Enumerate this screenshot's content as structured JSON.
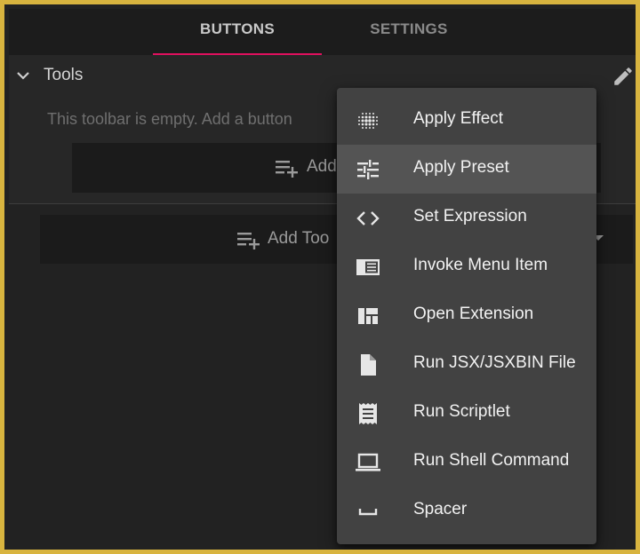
{
  "tabs": [
    {
      "label": "BUTTONS",
      "active": true
    },
    {
      "label": "SETTINGS",
      "active": false
    }
  ],
  "accent_color": "#e0115f",
  "frame_color": "#d8b43f",
  "section": {
    "title": "Tools",
    "empty_message": "This toolbar is empty. Add a button",
    "add_button_label": "Add",
    "add_toolbar_label": "Add Too"
  },
  "icons": {
    "chevron": "chevron-down-icon",
    "edit": "pencil-icon",
    "add": "playlist-add-icon",
    "dropdown": "caret-down-icon"
  },
  "menu": {
    "highlighted_index": 1,
    "items": [
      {
        "label": "Apply Effect",
        "icon": "dots-grid-icon"
      },
      {
        "label": "Apply Preset",
        "icon": "sliders-icon"
      },
      {
        "label": "Set Expression",
        "icon": "code-brackets-icon"
      },
      {
        "label": "Invoke Menu Item",
        "icon": "menu-panel-icon"
      },
      {
        "label": "Open Extension",
        "icon": "dashboard-layout-icon"
      },
      {
        "label": "Run JSX/JSXBIN File",
        "icon": "file-icon"
      },
      {
        "label": "Run Scriptlet",
        "icon": "receipt-icon"
      },
      {
        "label": "Run Shell Command",
        "icon": "laptop-icon"
      },
      {
        "label": "Spacer",
        "icon": "space-bar-icon"
      }
    ]
  }
}
